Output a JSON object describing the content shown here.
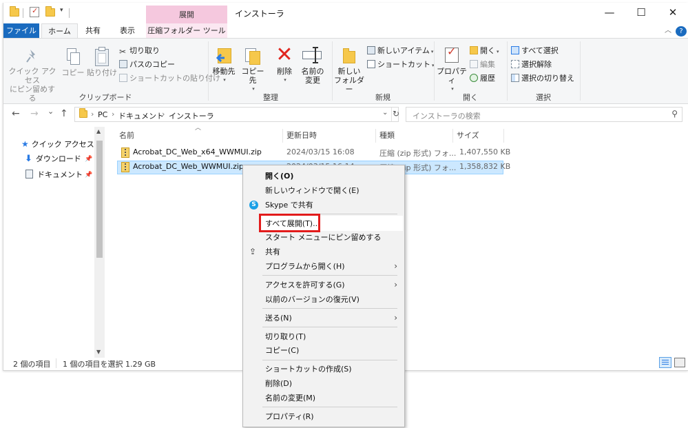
{
  "titlebar": {
    "context_tab_header": "展開",
    "window_title": "インストーラ",
    "minimize": "—",
    "maximize": "☐",
    "close": "✕"
  },
  "ribbon_tabs": {
    "file": "ファイル",
    "home": "ホーム",
    "share": "共有",
    "view": "表示",
    "compressed_tools": "圧縮フォルダー ツール",
    "collapse": "︿",
    "help": "?"
  },
  "ribbon": {
    "clipboard": {
      "group_label": "クリップボード",
      "pin_quick_access": [
        "クイック アクセス",
        "にピン留めする"
      ],
      "copy": "コピー",
      "paste": "貼り付け",
      "cut": "切り取り",
      "copy_path": "パスのコピー",
      "paste_shortcut": "ショートカットの貼り付け"
    },
    "organize": {
      "group_label": "整理",
      "move_to": "移動先",
      "copy_to": "コピー先",
      "delete": "削除",
      "rename": [
        "名前の",
        "変更"
      ]
    },
    "new": {
      "group_label": "新規",
      "new_folder": [
        "新しい",
        "フォルダー"
      ],
      "new_item": "新しいアイテム",
      "shortcut": "ショートカット"
    },
    "open": {
      "group_label": "開く",
      "properties": "プロパティ",
      "open": "開く",
      "edit": "編集",
      "history": "履歴"
    },
    "select": {
      "group_label": "選択",
      "select_all": "すべて選択",
      "select_none": "選択解除",
      "invert": "選択の切り替え"
    }
  },
  "address": {
    "back": "←",
    "forward": "→",
    "recent": "⌄",
    "up": "↑",
    "crumbs": [
      "PC",
      "ドキュメント",
      "インストーラ"
    ],
    "search_placeholder": "インストーラの検索"
  },
  "nav": {
    "quick_access": "クイック アクセス",
    "downloads": "ダウンロード",
    "documents": "ドキュメント"
  },
  "columns": {
    "name": "名前",
    "modified": "更新日時",
    "type": "種類",
    "size": "サイズ"
  },
  "files": [
    {
      "name": "Acrobat_DC_Web_x64_WWMUI.zip",
      "modified": "2024/03/15 16:08",
      "type": "圧縮 (zip 形式) フォ...",
      "size": "1,407,550 KB"
    },
    {
      "name": "Acrobat_DC_Web_WWMUI.zip",
      "modified": "2024/03/15 16:14",
      "type": "圧縮 (zip 形式) フォ...",
      "size": "1,358,832 KB"
    }
  ],
  "status": {
    "item_count": "2 個の項目",
    "selection": "1 個の項目を選択  1.29 GB"
  },
  "context_menu": {
    "open": "開く(O)",
    "open_new_window": "新しいウィンドウで開く(E)",
    "skype_share": "Skype で共有",
    "extract_all": "すべて展開(T)...",
    "pin_start": "スタート メニューにピン留めする",
    "share": "共有",
    "open_with": "プログラムから開く(H)",
    "give_access": "アクセスを許可する(G)",
    "restore_versions": "以前のバージョンの復元(V)",
    "send_to": "送る(N)",
    "cut": "切り取り(T)",
    "copy": "コピー(C)",
    "create_shortcut": "ショートカットの作成(S)",
    "delete": "削除(D)",
    "rename": "名前の変更(M)",
    "properties": "プロパティ(R)"
  },
  "colors": {
    "file_tab": "#1a6bbf",
    "context_tab": "#f5c8de",
    "selection": "#cce8ff",
    "highlight_box": "#e21b1b"
  }
}
